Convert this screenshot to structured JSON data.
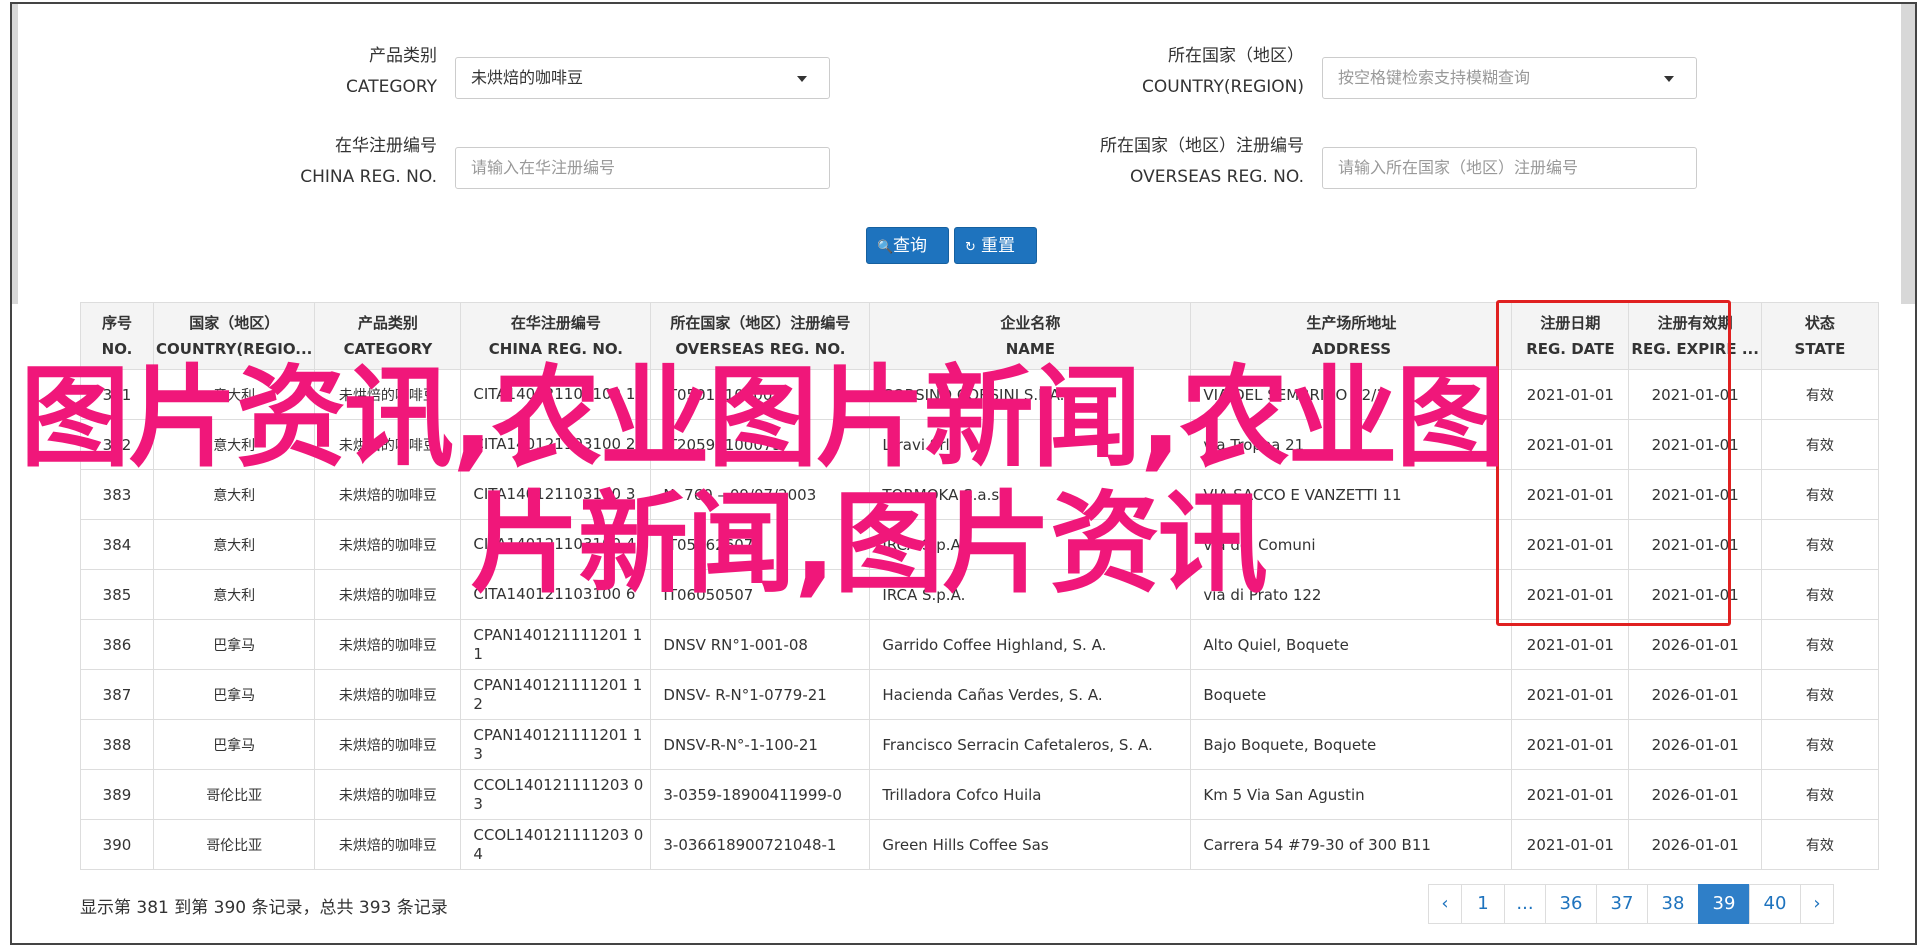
{
  "filters": {
    "category_label_cn": "产品类别",
    "category_label_en": "CATEGORY",
    "category_value": "未烘焙的咖啡豆",
    "country_label_cn": "所在国家（地区）",
    "country_label_en": "COUNTRY(REGION)",
    "country_placeholder": "按空格键检索支持模糊查询",
    "china_reg_label_cn": "在华注册编号",
    "china_reg_label_en": "CHINA REG. NO.",
    "china_reg_placeholder": "请输入在华注册编号",
    "overseas_reg_label_cn": "所在国家（地区）注册编号",
    "overseas_reg_label_en": "OVERSEAS REG. NO.",
    "overseas_reg_placeholder": "请输入所在国家（地区）注册编号",
    "search_button": "查询",
    "reset_button": "重置"
  },
  "table": {
    "headers": [
      {
        "cn": "序号",
        "en": "NO."
      },
      {
        "cn": "国家（地区）",
        "en": "COUNTRY(REGIO..."
      },
      {
        "cn": "产品类别",
        "en": "CATEGORY"
      },
      {
        "cn": "在华注册编号",
        "en": "CHINA REG. NO."
      },
      {
        "cn": "所在国家（地区）注册编号",
        "en": "OVERSEAS REG. NO."
      },
      {
        "cn": "企业名称",
        "en": "NAME"
      },
      {
        "cn": "生产场所地址",
        "en": "ADDRESS"
      },
      {
        "cn": "注册日期",
        "en": "REG. DATE"
      },
      {
        "cn": "注册有效期",
        "en": "REG. EXPIRE ..."
      },
      {
        "cn": "状态",
        "en": "STATE"
      }
    ],
    "rows": [
      {
        "no": "381",
        "country": "意大利",
        "category": "未烘焙的咖啡豆",
        "china_reg": "CITA140121103100 1",
        "overseas_reg": "IT05010100001",
        "name": "CORSINO CORSINI S.P.A.",
        "address": "VIA DEL SEMBRINO 62/1",
        "reg_date": "2021-01-01",
        "expire": "2021-01-01",
        "state": "有效"
      },
      {
        "no": "382",
        "country": "意大利",
        "category": "未烘焙的咖啡豆",
        "china_reg": "CITA140121103100 2",
        "overseas_reg": "IT20590100073",
        "name": "Ltravi Srl",
        "address": "via Tropea 21",
        "reg_date": "2021-01-01",
        "expire": "2021-01-01",
        "state": "有效"
      },
      {
        "no": "383",
        "country": "意大利",
        "category": "未烘焙的咖啡豆",
        "china_reg": "CITA140121103100 3",
        "overseas_reg": "N. 760 – 09/07/2003",
        "name": "TORMOKA S.a.s.",
        "address": "VIA SACCO E VANZETTI 11",
        "reg_date": "2021-01-01",
        "expire": "2021-01-01",
        "state": "有效"
      },
      {
        "no": "384",
        "country": "意大利",
        "category": "未烘焙的咖啡豆",
        "china_reg": "CITA140121103100 4",
        "overseas_reg": "IT05062607",
        "name": "IRCA S.p.A.",
        "address": "via dei Comuni",
        "reg_date": "2021-01-01",
        "expire": "2021-01-01",
        "state": "有效"
      },
      {
        "no": "385",
        "country": "意大利",
        "category": "未烘焙的咖啡豆",
        "china_reg": "CITA140121103100 6",
        "overseas_reg": "IT06050507",
        "name": "IRCA S.p.A.",
        "address": "via di Prato 122",
        "reg_date": "2021-01-01",
        "expire": "2021-01-01",
        "state": "有效"
      },
      {
        "no": "386",
        "country": "巴拿马",
        "category": "未烘焙的咖啡豆",
        "china_reg": "CPAN140121111201 11",
        "overseas_reg": "DNSV RN°1-001-08",
        "name": "Garrido Coffee Highland, S. A.",
        "address": "Alto Quiel, Boquete",
        "reg_date": "2021-01-01",
        "expire": "2026-01-01",
        "state": "有效"
      },
      {
        "no": "387",
        "country": "巴拿马",
        "category": "未烘焙的咖啡豆",
        "china_reg": "CPAN140121111201 12",
        "overseas_reg": "DNSV- R-N°1-0779-21",
        "name": "Hacienda Cañas Verdes, S. A.",
        "address": "Boquete",
        "reg_date": "2021-01-01",
        "expire": "2026-01-01",
        "state": "有效"
      },
      {
        "no": "388",
        "country": "巴拿马",
        "category": "未烘焙的咖啡豆",
        "china_reg": "CPAN140121111201 13",
        "overseas_reg": "DNSV-R-N°-1-100-21",
        "name": "Francisco Serracin Cafetaleros, S. A.",
        "address": "Bajo Boquete, Boquete",
        "reg_date": "2021-01-01",
        "expire": "2026-01-01",
        "state": "有效"
      },
      {
        "no": "389",
        "country": "哥伦比亚",
        "category": "未烘焙的咖啡豆",
        "china_reg": "CCOL140121111203 03",
        "overseas_reg": "3-0359-18900411999-0",
        "name": "Trilladora Cofco Huila",
        "address": "Km 5 Via San Agustin",
        "reg_date": "2021-01-01",
        "expire": "2026-01-01",
        "state": "有效"
      },
      {
        "no": "390",
        "country": "哥伦比亚",
        "category": "未烘焙的咖啡豆",
        "china_reg": "CCOL140121111203 04",
        "overseas_reg": "3-036618900721048-1",
        "name": "Green Hills Coffee Sas",
        "address": "Carrera 54 #79-30 of 300 B11",
        "reg_date": "2021-01-01",
        "expire": "2026-01-01",
        "state": "有效"
      }
    ]
  },
  "watermark": {
    "line1": "图片资讯,农业图片新闻,农业图",
    "line2": "片新闻,图片资讯"
  },
  "pagination": {
    "summary": "显示第 381 到第 390 条记录，总共 393 条记录",
    "pages": [
      "‹",
      "1",
      "...",
      "36",
      "37",
      "38",
      "39",
      "40",
      "›"
    ],
    "active": "39"
  },
  "colors": {
    "accent": "#1e73be",
    "watermark": "#f0177a",
    "highlight_box": "#e02020"
  }
}
